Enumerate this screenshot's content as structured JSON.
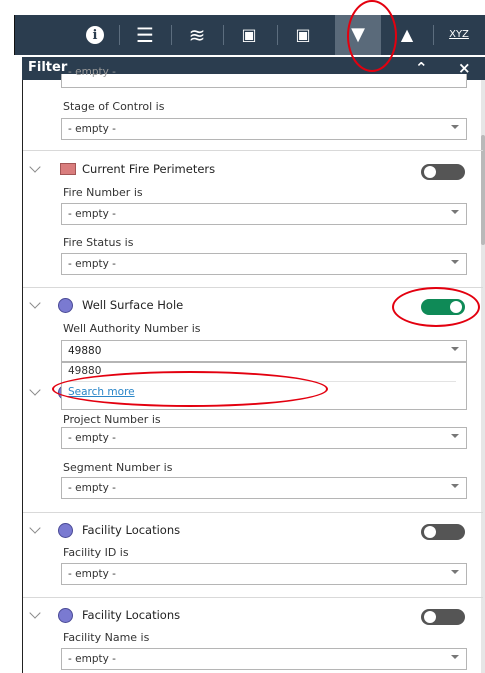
{
  "toolbar": {
    "items": [
      {
        "name": "info",
        "glyph": "i"
      },
      {
        "name": "list",
        "glyph": "☰"
      },
      {
        "name": "layers",
        "glyph": "≋"
      },
      {
        "name": "query",
        "glyph": "▣"
      },
      {
        "name": "query-2",
        "glyph": "▣"
      },
      {
        "name": "filter",
        "glyph": "▼"
      },
      {
        "name": "map",
        "glyph": "▲"
      },
      {
        "name": "coordinates",
        "glyph": "XYZ"
      }
    ]
  },
  "panel": {
    "title": "Filter",
    "collapse_glyph": "⌃",
    "close_glyph": "×"
  },
  "filters": {
    "top_partial": {
      "value": "- empty -"
    },
    "stage_of_control": {
      "label": "Stage of Control is",
      "value": "- empty -"
    },
    "fire_perimeters": {
      "name": "Current Fire Perimeters",
      "toggle": "off",
      "fire_number": {
        "label": "Fire Number is",
        "value": "- empty -"
      },
      "fire_status": {
        "label": "Fire Status is",
        "value": "- empty -"
      }
    },
    "well_surface": {
      "name": "Well Surface Hole",
      "toggle": "on",
      "authority": {
        "label": "Well Authority Number is",
        "value": "49880"
      },
      "dropdown": {
        "option": "49880",
        "more": "Search more"
      }
    },
    "pipeline": {
      "project": {
        "label": "Project Number is",
        "value": "- empty -"
      },
      "segment": {
        "label": "Segment Number is",
        "value": "- empty -"
      }
    },
    "facility_id": {
      "name": "Facility Locations",
      "toggle": "off",
      "field": {
        "label": "Facility ID is",
        "value": "- empty -"
      }
    },
    "facility_name": {
      "name": "Facility Locations",
      "toggle": "off",
      "field": {
        "label": "Facility Name is",
        "value": "- empty -"
      }
    }
  },
  "colors": {
    "toolbar": "#2b3d4f",
    "toggle_on": "#0f8a57",
    "toggle_off": "#555555",
    "fire_symbol": "#d97d7d",
    "point_symbol": "#7a7ad1",
    "link": "#2a86c8",
    "annotation": "#e3000f"
  }
}
